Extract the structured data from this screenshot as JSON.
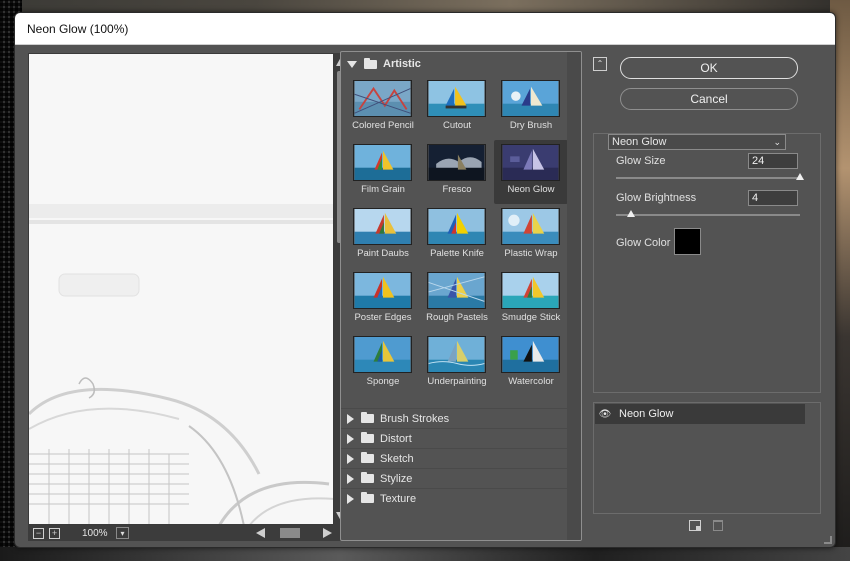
{
  "window": {
    "title": "Neon Glow (100%)"
  },
  "preview": {
    "zoom": "100%"
  },
  "gallery": {
    "expanded_category": "Artistic",
    "filters": [
      {
        "label": "Colored Pencil",
        "icon": "colored-pencil-thumbnail"
      },
      {
        "label": "Cutout",
        "icon": "cutout-thumbnail"
      },
      {
        "label": "Dry Brush",
        "icon": "dry-brush-thumbnail"
      },
      {
        "label": "Film Grain",
        "icon": "film-grain-thumbnail"
      },
      {
        "label": "Fresco",
        "icon": "fresco-thumbnail"
      },
      {
        "label": "Neon Glow",
        "icon": "neon-glow-thumbnail"
      },
      {
        "label": "Paint Daubs",
        "icon": "paint-daubs-thumbnail"
      },
      {
        "label": "Palette Knife",
        "icon": "palette-knife-thumbnail"
      },
      {
        "label": "Plastic Wrap",
        "icon": "plastic-wrap-thumbnail"
      },
      {
        "label": "Poster Edges",
        "icon": "poster-edges-thumbnail"
      },
      {
        "label": "Rough Pastels",
        "icon": "rough-pastels-thumbnail"
      },
      {
        "label": "Smudge Stick",
        "icon": "smudge-stick-thumbnail"
      },
      {
        "label": "Sponge",
        "icon": "sponge-thumbnail"
      },
      {
        "label": "Underpainting",
        "icon": "underpainting-thumbnail"
      },
      {
        "label": "Watercolor",
        "icon": "watercolor-thumbnail"
      }
    ],
    "selected_filter": "Neon Glow",
    "collapsed_categories": [
      "Brush Strokes",
      "Distort",
      "Sketch",
      "Stylize",
      "Texture"
    ]
  },
  "buttons": {
    "ok": "OK",
    "cancel": "Cancel"
  },
  "settings": {
    "filter_select": "Neon Glow",
    "glow_size_label": "Glow Size",
    "glow_size_value": "24",
    "glow_size_fraction": 1.0,
    "glow_brightness_label": "Glow Brightness",
    "glow_brightness_value": "4",
    "glow_brightness_fraction": 0.08,
    "glow_color_label": "Glow Color",
    "glow_color": "#000000"
  },
  "layers": {
    "items": [
      {
        "name": "Neon Glow"
      }
    ]
  },
  "colors": {
    "dialog_bg": "#535353",
    "selected_thumb": "#3a3a3a",
    "preview_bg": "#f6f6f6"
  }
}
